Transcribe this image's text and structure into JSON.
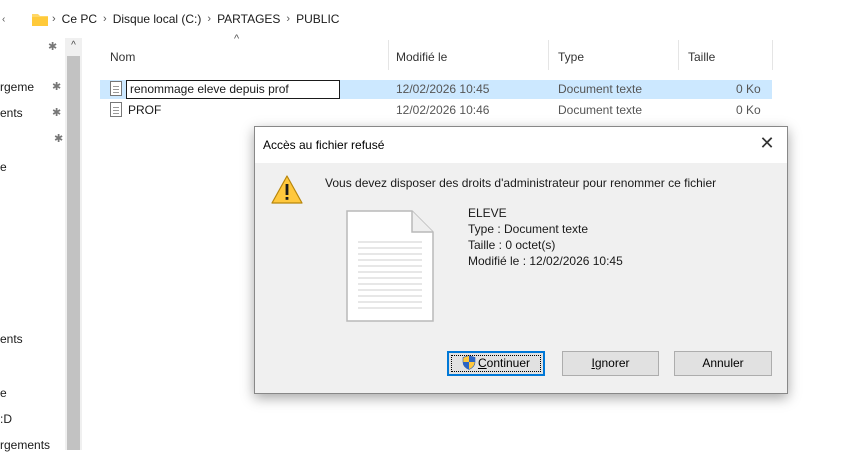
{
  "addressbar": {
    "crumbs": [
      "Ce PC",
      "Disque local (C:)",
      "PARTAGES",
      "PUBLIC"
    ],
    "separator": "›"
  },
  "nav": {
    "items": [
      "rgeme",
      "ents",
      "e",
      "ents",
      "e",
      ":D",
      "rgements"
    ]
  },
  "columns": {
    "name": "Nom",
    "modified": "Modifié le",
    "type": "Type",
    "size": "Taille"
  },
  "files": [
    {
      "name": "renommage eleve depuis prof",
      "modified": "12/02/2026 10:45",
      "type": "Document texte",
      "size": "0 Ko",
      "renaming": true
    },
    {
      "name": "PROF",
      "modified": "12/02/2026 10:46",
      "type": "Document texte",
      "size": "0 Ko",
      "renaming": false
    }
  ],
  "dialog": {
    "title": "Accès au fichier refusé",
    "message": "Vous devez disposer des droits d'administrateur pour renommer ce fichier",
    "file_name": "ELEVE",
    "file_type": "Type : Document texte",
    "file_size": "Taille : 0 octet(s)",
    "file_modified": "Modifié le : 12/02/2026 10:45",
    "buttons": {
      "continue_first": "C",
      "continue_rest": "ontinuer",
      "ignore_first": "I",
      "ignore_rest": "gnorer",
      "cancel": "Annuler"
    }
  },
  "colors": {
    "selection": "#cce8ff",
    "accent": "#0078d7",
    "dialog_bg": "#f0f0f0",
    "warning": "#ffc83d"
  }
}
